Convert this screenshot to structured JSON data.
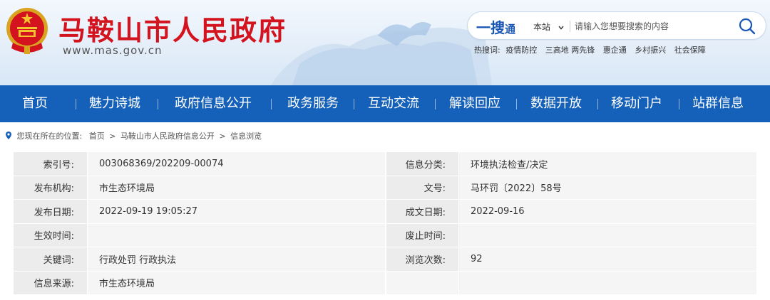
{
  "site": {
    "title": "马鞍山市人民政府",
    "url": "www.mas.gov.cn"
  },
  "search": {
    "logo_part1": "一搜",
    "logo_part2": "通",
    "scope": "本站",
    "placeholder": "请输入您想要搜索的内容",
    "hot_label": "热搜词:",
    "hot_terms": [
      "疫情防控",
      "三高地 两先锋",
      "惠企通",
      "乡村振兴",
      "社会保障"
    ]
  },
  "nav": {
    "items": [
      "首页",
      "魅力诗城",
      "政府信息公开",
      "政务服务",
      "互动交流",
      "解读回应",
      "数据开放",
      "移动门户",
      "站群信息"
    ]
  },
  "breadcrumb": {
    "prefix": "您现在所在的位置:",
    "items": [
      "首页",
      "马鞍山市人民政府信息公开",
      "信息浏览"
    ],
    "separator": ">"
  },
  "info": {
    "rows": [
      {
        "l1": "索引号:",
        "v1": "003068369/202209-00074",
        "l2": "信息分类:",
        "v2": "环境执法检查/决定"
      },
      {
        "l1": "发布机构:",
        "v1": "市生态环境局",
        "l2": "文号:",
        "v2": "马环罚〔2022〕58号"
      },
      {
        "l1": "发布日期:",
        "v1": "2022-09-19 19:05:27",
        "l2": "成文日期:",
        "v2": "2022-09-16"
      },
      {
        "l1": "生效时间:",
        "v1": "",
        "l2": "废止时间:",
        "v2": ""
      },
      {
        "l1": "关键词:",
        "v1": "行政处罚 行政执法",
        "l2": "浏览次数:",
        "v2": "92"
      },
      {
        "l1": "信息来源:",
        "v1": "市生态环境局",
        "l2": "",
        "v2": ""
      }
    ]
  },
  "colors": {
    "brand_red": "#d3141f",
    "nav_blue": "#1560b8",
    "search_blue": "#1a57b5"
  }
}
